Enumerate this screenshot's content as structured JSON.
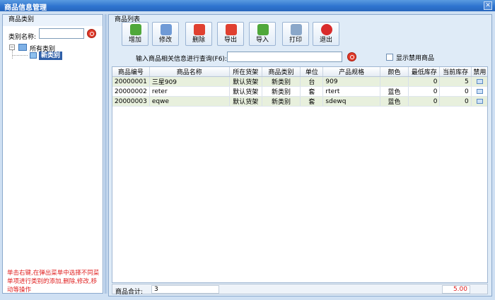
{
  "window": {
    "title": "商品信息管理",
    "close": "✕"
  },
  "left": {
    "group_title": "商品类别",
    "category_label": "类别名称:",
    "category_value": "",
    "tree": {
      "root_label": "所有类别",
      "expander": "−",
      "child_label": "新类别"
    },
    "tip": "单击右键,在弹出菜单中选择不同菜单项进行类别的添加,删除,修改,移动等操作"
  },
  "right": {
    "group_title": "商品列表",
    "toolbar": [
      {
        "label": "增加",
        "icon": "add-icon",
        "color": "#4fa83a"
      },
      {
        "label": "修改",
        "icon": "edit-icon",
        "color": "#6f9ad6"
      },
      {
        "label": "删除",
        "icon": "delete-icon",
        "color": "#e04030"
      },
      {
        "label": "导出",
        "icon": "export-icon",
        "color": "#e04030"
      },
      {
        "label": "导入",
        "icon": "import-icon",
        "color": "#4fa83a"
      },
      {
        "label": "打印",
        "icon": "print-icon",
        "color": "#8aa7c9"
      },
      {
        "label": "退出",
        "icon": "exit-icon",
        "color": "#d92b2b"
      }
    ],
    "query_label": "输入商品相关信息进行查询(F6):",
    "query_value": "",
    "show_disabled_label": "显示禁用商品",
    "columns": [
      "商品编号",
      "商品名称",
      "所在货架",
      "商品类别",
      "单位",
      "产品规格",
      "颜色",
      "最低库存",
      "当前库存",
      "禁用"
    ],
    "rows": [
      [
        "20000001",
        "三星909",
        "默认货架",
        "新类别",
        "台",
        "909",
        "",
        "0",
        "5"
      ],
      [
        "20000002",
        "reter",
        "默认货架",
        "新类别",
        "套",
        "rtert",
        "蓝色",
        "0",
        "0"
      ],
      [
        "20000003",
        "eqwe",
        "默认货架",
        "新类别",
        "套",
        "sdewq",
        "蓝色",
        "0",
        "0"
      ]
    ],
    "footer": {
      "total_label": "商品合计:",
      "total_count": "3",
      "total_sum": "5.00"
    }
  },
  "colors": {
    "titlebar": "#2f74cf",
    "tip_text": "#e02020",
    "selected": "#2f5fa8"
  }
}
